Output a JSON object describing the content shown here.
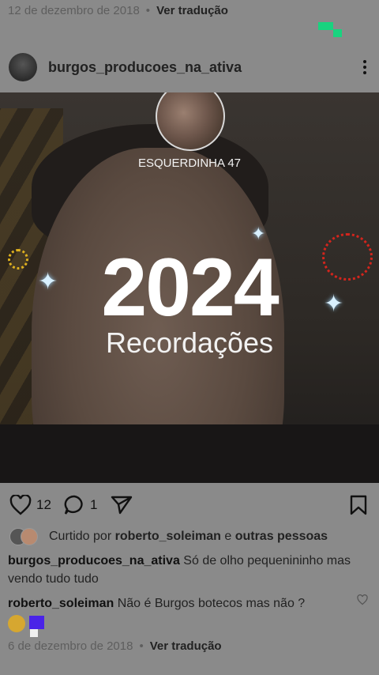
{
  "top": {
    "date": "12 de dezembro de 2018",
    "dot": "•",
    "translate": "Ver tradução"
  },
  "post": {
    "username": "burgos_producoes_na_ativa",
    "story_name": "ESQUERDINHA 47",
    "year": "2024",
    "subtitle": "Recordações"
  },
  "actions": {
    "likes": "12",
    "comments": "1"
  },
  "liked": {
    "prefix": "Curtido por",
    "user": "roberto_soleiman",
    "mid": "e",
    "others": "outras pessoas"
  },
  "caption": {
    "user": "burgos_producoes_na_ativa",
    "text": "Só de olho pequenininho mas vendo tudo tudo"
  },
  "comment": {
    "user": "roberto_soleiman",
    "text": "Não é Burgos botecos mas não ?"
  },
  "bottom": {
    "date": "6 de dezembro de 2018",
    "dot": "•",
    "translate": "Ver tradução"
  },
  "colors": {
    "accent_green": "#19d37f",
    "sparkle": "#d8f0ff",
    "ring_red": "#d3251d",
    "sun_gold": "#e0b21f"
  },
  "icons": [
    "more-icon",
    "heart-icon",
    "comment-icon",
    "share-icon",
    "bookmark-icon",
    "sparkle-icon"
  ]
}
